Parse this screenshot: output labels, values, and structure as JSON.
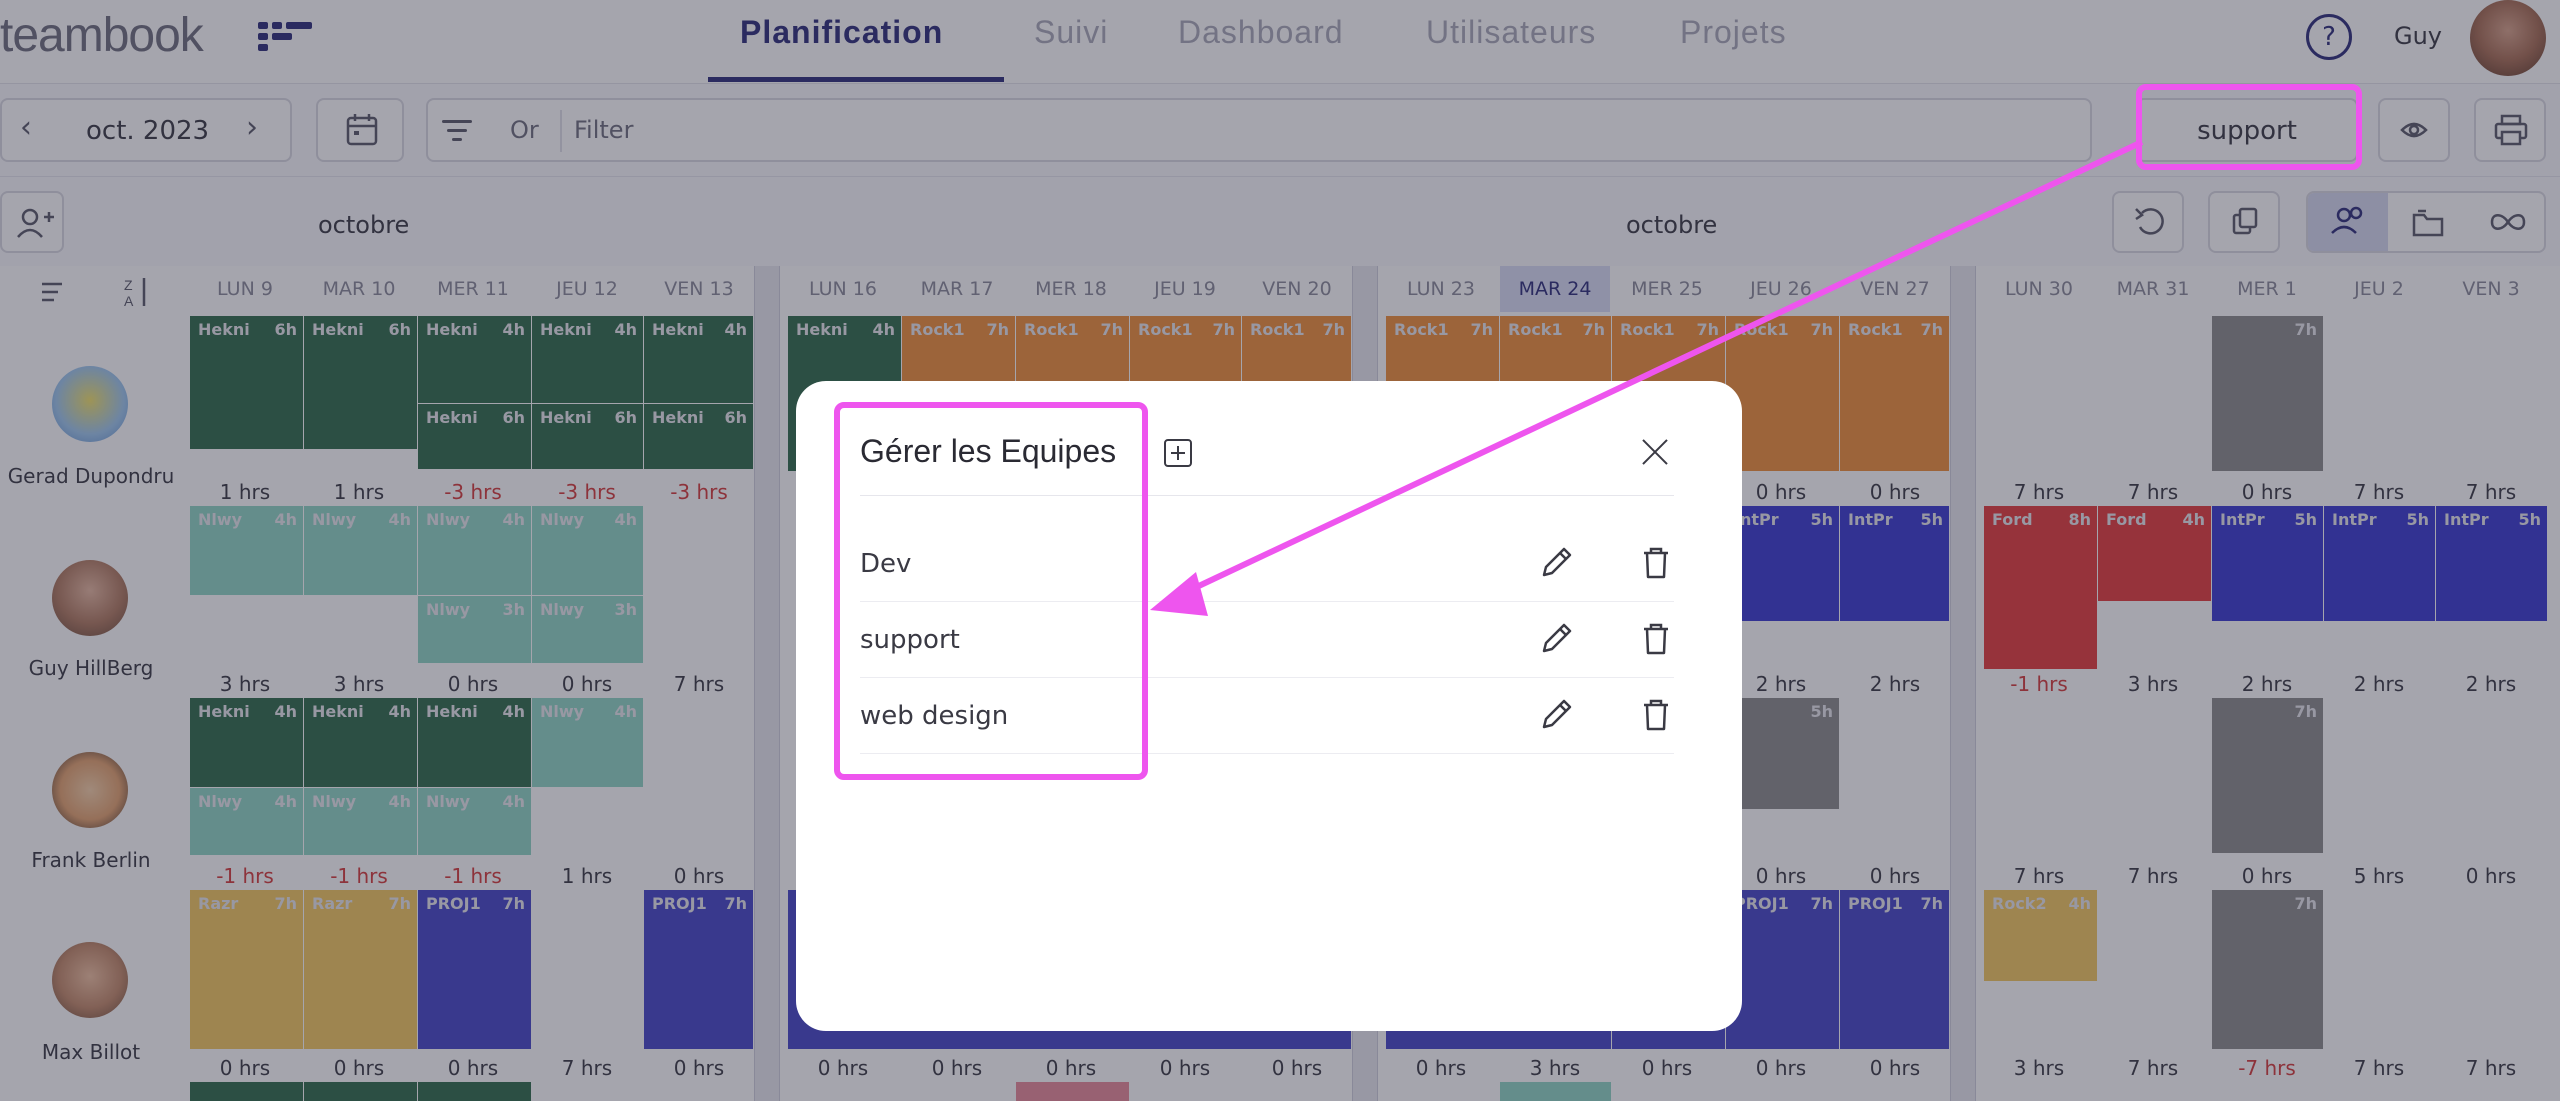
{
  "header": {
    "logo_text": "teambook",
    "tabs": [
      {
        "label": "Planification",
        "active": true
      },
      {
        "label": "Suivi"
      },
      {
        "label": "Dashboard"
      },
      {
        "label": "Utilisateurs"
      },
      {
        "label": "Projets"
      }
    ],
    "help_label": "?",
    "user_name": "Guy"
  },
  "toolbar": {
    "date_label": "oct. 2023",
    "or_label": "Or",
    "filter_placeholder": "Filter",
    "team_button_label": "support"
  },
  "calendar": {
    "month_labels": [
      "octobre",
      "octobre"
    ],
    "days": [
      "LUN 9",
      "MAR 10",
      "MER 11",
      "JEU 12",
      "VEN 13",
      "LUN 16",
      "MAR 17",
      "MER 18",
      "JEU 19",
      "VEN 20",
      "LUN 23",
      "MAR 24",
      "MER 25",
      "JEU 26",
      "VEN 27",
      "LUN 30",
      "MAR 31",
      "MER 1",
      "JEU 2",
      "VEN 3"
    ],
    "people": [
      {
        "name": "Gerad Dupondru",
        "hours": [
          "1 hrs",
          "1 hrs",
          "-3 hrs",
          "-3 hrs",
          "-3 hrs",
          "",
          "",
          "",
          "",
          "",
          "",
          "",
          "",
          "0 hrs",
          "0 hrs",
          "7 hrs",
          "7 hrs",
          "0 hrs",
          "7 hrs",
          "7 hrs"
        ]
      },
      {
        "name": "Guy HillBerg",
        "hours": [
          "3 hrs",
          "3 hrs",
          "0 hrs",
          "0 hrs",
          "7 hrs",
          "",
          "",
          "",
          "",
          "",
          "",
          "",
          "",
          "2 hrs",
          "2 hrs",
          "-1 hrs",
          "3 hrs",
          "2 hrs",
          "2 hrs",
          "2 hrs"
        ]
      },
      {
        "name": "Frank Berlin",
        "hours": [
          "-1 hrs",
          "-1 hrs",
          "-1 hrs",
          "1 hrs",
          "0 hrs",
          "",
          "",
          "",
          "",
          "",
          "",
          "",
          "",
          "0 hrs",
          "0 hrs",
          "7 hrs",
          "7 hrs",
          "0 hrs",
          "5 hrs",
          "0 hrs"
        ]
      },
      {
        "name": "Max Billot",
        "hours": [
          "0 hrs",
          "0 hrs",
          "0 hrs",
          "7 hrs",
          "0 hrs",
          "0 hrs",
          "0 hrs",
          "0 hrs",
          "0 hrs",
          "0 hrs",
          "0 hrs",
          "3 hrs",
          "0 hrs",
          "0 hrs",
          "0 hrs",
          "3 hrs",
          "7 hrs",
          "-7 hrs",
          "7 hrs",
          "7 hrs"
        ]
      }
    ]
  },
  "modal": {
    "title": "Gérer les Equipes",
    "teams": [
      {
        "name": "Dev"
      },
      {
        "name": "support"
      },
      {
        "name": "web design"
      }
    ]
  },
  "colors": {
    "brand": "#2d2d7a",
    "highlight": "#ee55ee",
    "hekni": "#2f6b4a",
    "nlwy": "#8fd6c4",
    "rock1": "#ef8f3a",
    "intpr": "#3a3ad0",
    "ford": "#e63b3b",
    "grey_task": "#8c8c8c",
    "razr": "#f3c860",
    "proj1": "#4545c8"
  }
}
